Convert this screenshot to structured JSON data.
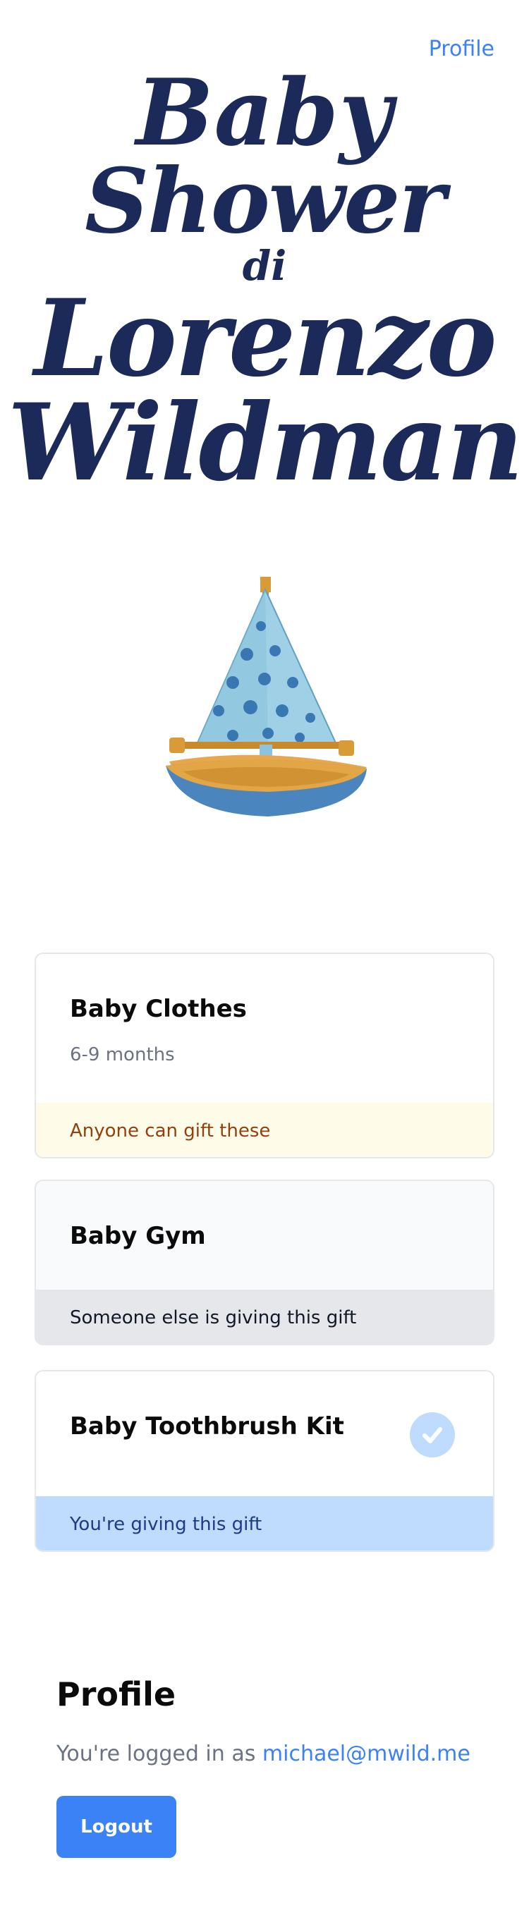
{
  "nav": {
    "profile_link": "Profile"
  },
  "title": {
    "line1": "Baby",
    "line2": "Shower",
    "line3": "di",
    "line4": "Lorenzo",
    "line5": "Wildman"
  },
  "colors": {
    "accent": "#3b82f6",
    "title": "#1b2a59",
    "available_bg": "#fefbe8",
    "taken_bg": "#e5e7eb",
    "mine_bg": "#bfdbfe"
  },
  "gifts": [
    {
      "name": "Baby Clothes",
      "detail": "6-9 months",
      "status": "Anyone can gift these"
    },
    {
      "name": "Baby Gym",
      "detail": "",
      "status": "Someone else is giving this gift"
    },
    {
      "name": "Baby Toothbrush Kit",
      "detail": "",
      "status": "You're giving this gift",
      "icon": "check-icon"
    }
  ],
  "profile": {
    "heading": "Profile",
    "logged_in_prefix": "You're logged in as",
    "email": "michael@mwild.me",
    "logout_label": "Logout"
  }
}
